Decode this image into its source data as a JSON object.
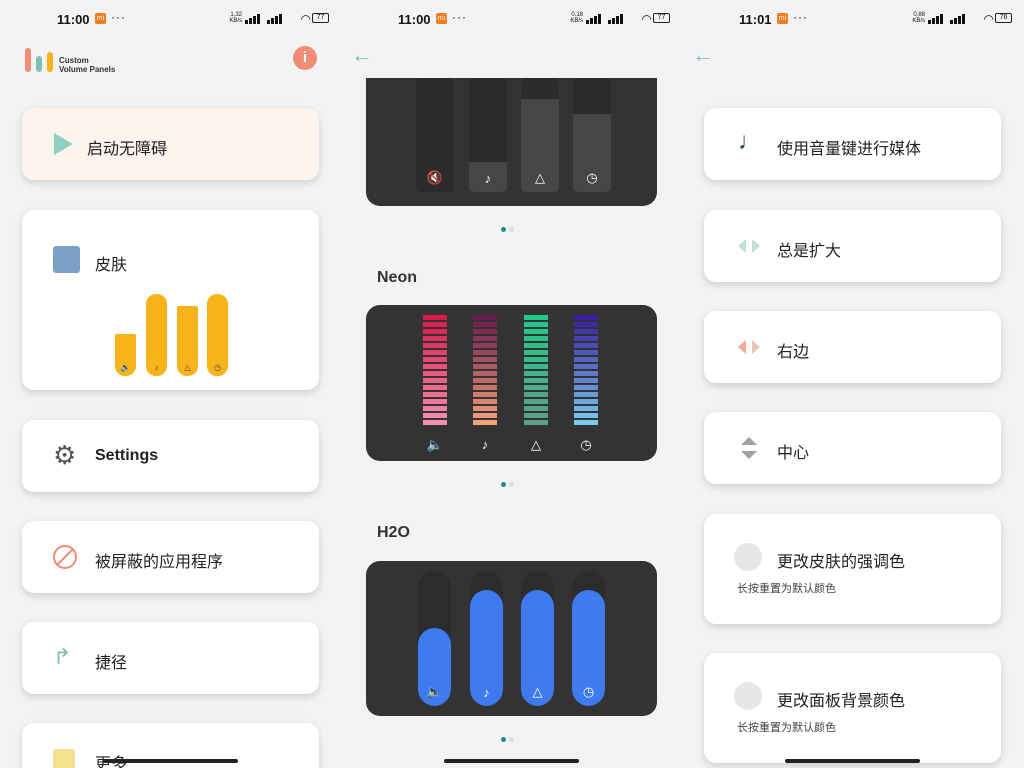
{
  "screens": [
    {
      "status": {
        "time": "11:00",
        "rate": "1.32 KB/s",
        "battery": "77"
      },
      "app_name_line1": "Custom",
      "app_name_line2": "Volume Panels",
      "info_label": "i",
      "cards": {
        "accessibility": "启动无障碍",
        "skin": "皮肤",
        "settings": "Settings",
        "blocked_apps": "被屏蔽的应用程序",
        "shortcut": "捷径",
        "more": "更多"
      }
    },
    {
      "status": {
        "time": "11:00",
        "rate": "0.18 KB/s",
        "battery": "77"
      },
      "themes": [
        {
          "name": ""
        },
        {
          "name": "Neon"
        },
        {
          "name": "H2O"
        }
      ],
      "levels": {
        "theme1": {
          "media_mute": 0.0,
          "music": 0.26,
          "ring": 0.82,
          "alarm": 0.68
        },
        "h2o": {
          "media": 0.58,
          "music": 0.86,
          "ring": 0.86,
          "alarm": 0.86
        }
      }
    },
    {
      "status": {
        "time": "11:01",
        "rate": "0.88 KB/s",
        "battery": "76"
      },
      "options": {
        "media_keys": "使用音量键进行媒体",
        "always_expand": "总是扩大",
        "right_side": "右边",
        "center": "中心",
        "accent_color": "更改皮肤的强调色",
        "accent_hint": "长按重置为默认颜色",
        "bg_color": "更改面板背景颜色",
        "bg_hint": "长按重置为默认颜色"
      }
    }
  ],
  "colors": {
    "accent_teal": "#7fbfb8",
    "info_orange": "#ef8d77",
    "skin_yellow": "#f8b21a",
    "h2o_blue": "#3f7af0"
  },
  "icons": [
    "play-icon",
    "skin-icon",
    "gear-icon",
    "block-icon",
    "shortcut-icon",
    "music-note-icon",
    "expand-icon",
    "right-side-icon",
    "center-icon"
  ]
}
